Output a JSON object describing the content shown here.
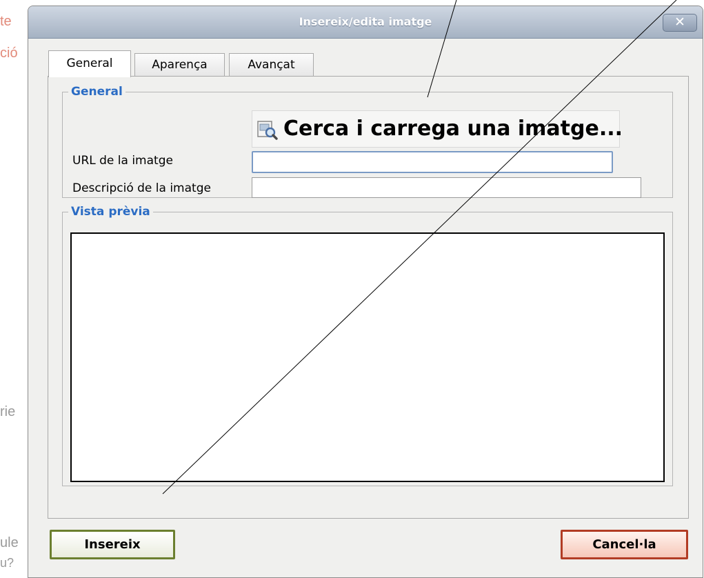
{
  "background_fragments": [
    "te",
    "ció",
    "rie",
    "ule",
    "u?"
  ],
  "dialog": {
    "title": "Insereix/edita imatge",
    "close_label": "✕",
    "tabs": [
      {
        "label": "General",
        "active": true
      },
      {
        "label": "Aparença",
        "active": false
      },
      {
        "label": "Avançat",
        "active": false
      }
    ],
    "general": {
      "legend": "General",
      "browse_label": "Cerca i carrega una imatge...",
      "browse_icon": "image-search-icon",
      "url_label": "URL de la imatge",
      "url_value": "",
      "description_label": "Descripció de la imatge",
      "description_value": ""
    },
    "preview": {
      "legend": "Vista prèvia"
    },
    "buttons": {
      "insert_label": "Insereix",
      "cancel_label": "Cancel·la"
    }
  },
  "colors": {
    "legend": "#2b6cc4",
    "titlebar": "#a5b2c3",
    "insert_border": "#6b7f2f",
    "cancel_border": "#b23c24",
    "background_text": "#e28a7a"
  }
}
